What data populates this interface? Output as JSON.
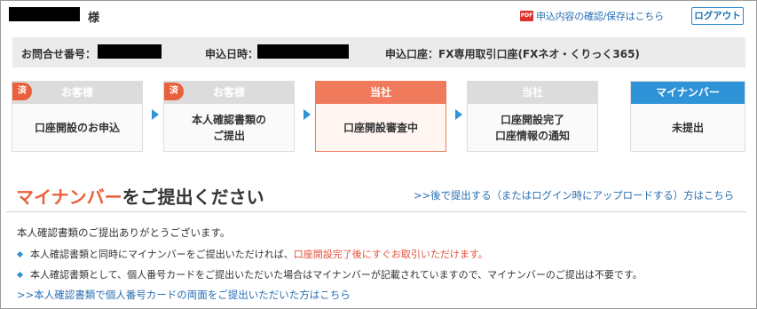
{
  "header": {
    "honorific": "様",
    "pdf_icon_label": "PDF",
    "pdf_link": "申込内容の確認/保存はこちら",
    "logout": "ログアウト"
  },
  "info": {
    "inquiry_label": "お問合せ番号：",
    "date_label": "申込日時：",
    "account_label": "申込口座：FX専用取引口座(FXネオ・くりっく365)"
  },
  "steps": [
    {
      "badge": "済",
      "head": "お客様",
      "body": "口座開設のお申込",
      "state": "done"
    },
    {
      "badge": "済",
      "head": "お客様",
      "body": "本人確認書類の\nご提出",
      "state": "done"
    },
    {
      "badge": "",
      "head": "当社",
      "body": "口座開設審査中",
      "state": "current"
    },
    {
      "badge": "",
      "head": "当社",
      "body": "口座開設完了\n口座情報の通知",
      "state": "pending"
    },
    {
      "badge": "",
      "head": "マイナンバー",
      "body": "未提出",
      "state": "mynumber"
    }
  ],
  "section": {
    "title_accent": "マイナンバー",
    "title_rest": "をご提出ください",
    "later_link": ">>後で提出する（またはログイン時にアップロードする）方はこちら"
  },
  "notes": {
    "thanks": "本人確認書類のご提出ありがとうございます。",
    "bullet1_prefix": "本人確認書類と同時にマイナンバーをご提出いただければ、",
    "bullet1_red": "口座開設完了後にすぐお取引いただけます。",
    "bullet2": "本人確認書類として、個人番号カードをご提出いただいた場合はマイナンバーが記載されていますので、マイナンバーのご提出は不要です。",
    "bottom_link": ">>本人確認書類で個人番号カードの両面をご提出いただいた方はこちら"
  },
  "colors": {
    "accent_orange": "#e8613c",
    "step_blue": "#2f93d7",
    "link_blue": "#2a6fb3",
    "done_gray": "#dcdcdc"
  }
}
